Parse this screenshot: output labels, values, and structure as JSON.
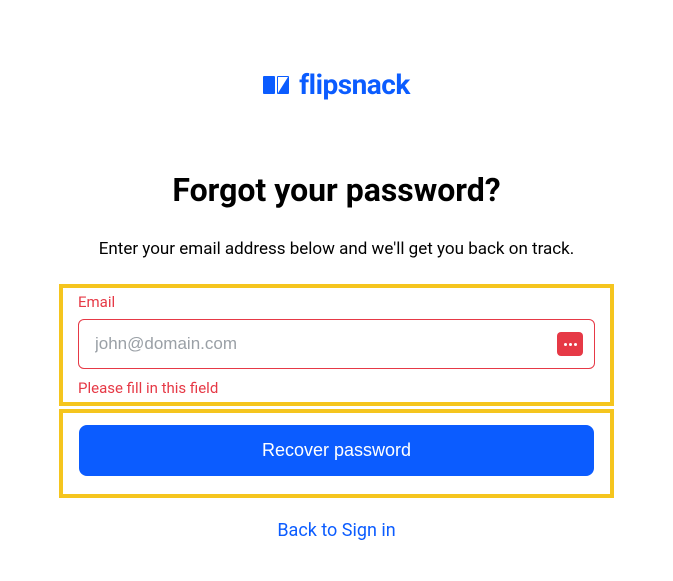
{
  "brand": {
    "name": "flipsnack"
  },
  "heading": "Forgot your password?",
  "subtitle": "Enter your email address below and we'll get you back on track.",
  "email": {
    "label": "Email",
    "placeholder": "john@domain.com",
    "value": "",
    "error": "Please fill in this field"
  },
  "recover_button": "Recover password",
  "back_link": "Back to Sign in",
  "colors": {
    "brand": "#0b5cff",
    "error": "#e63946",
    "highlight": "#f5c51e"
  }
}
